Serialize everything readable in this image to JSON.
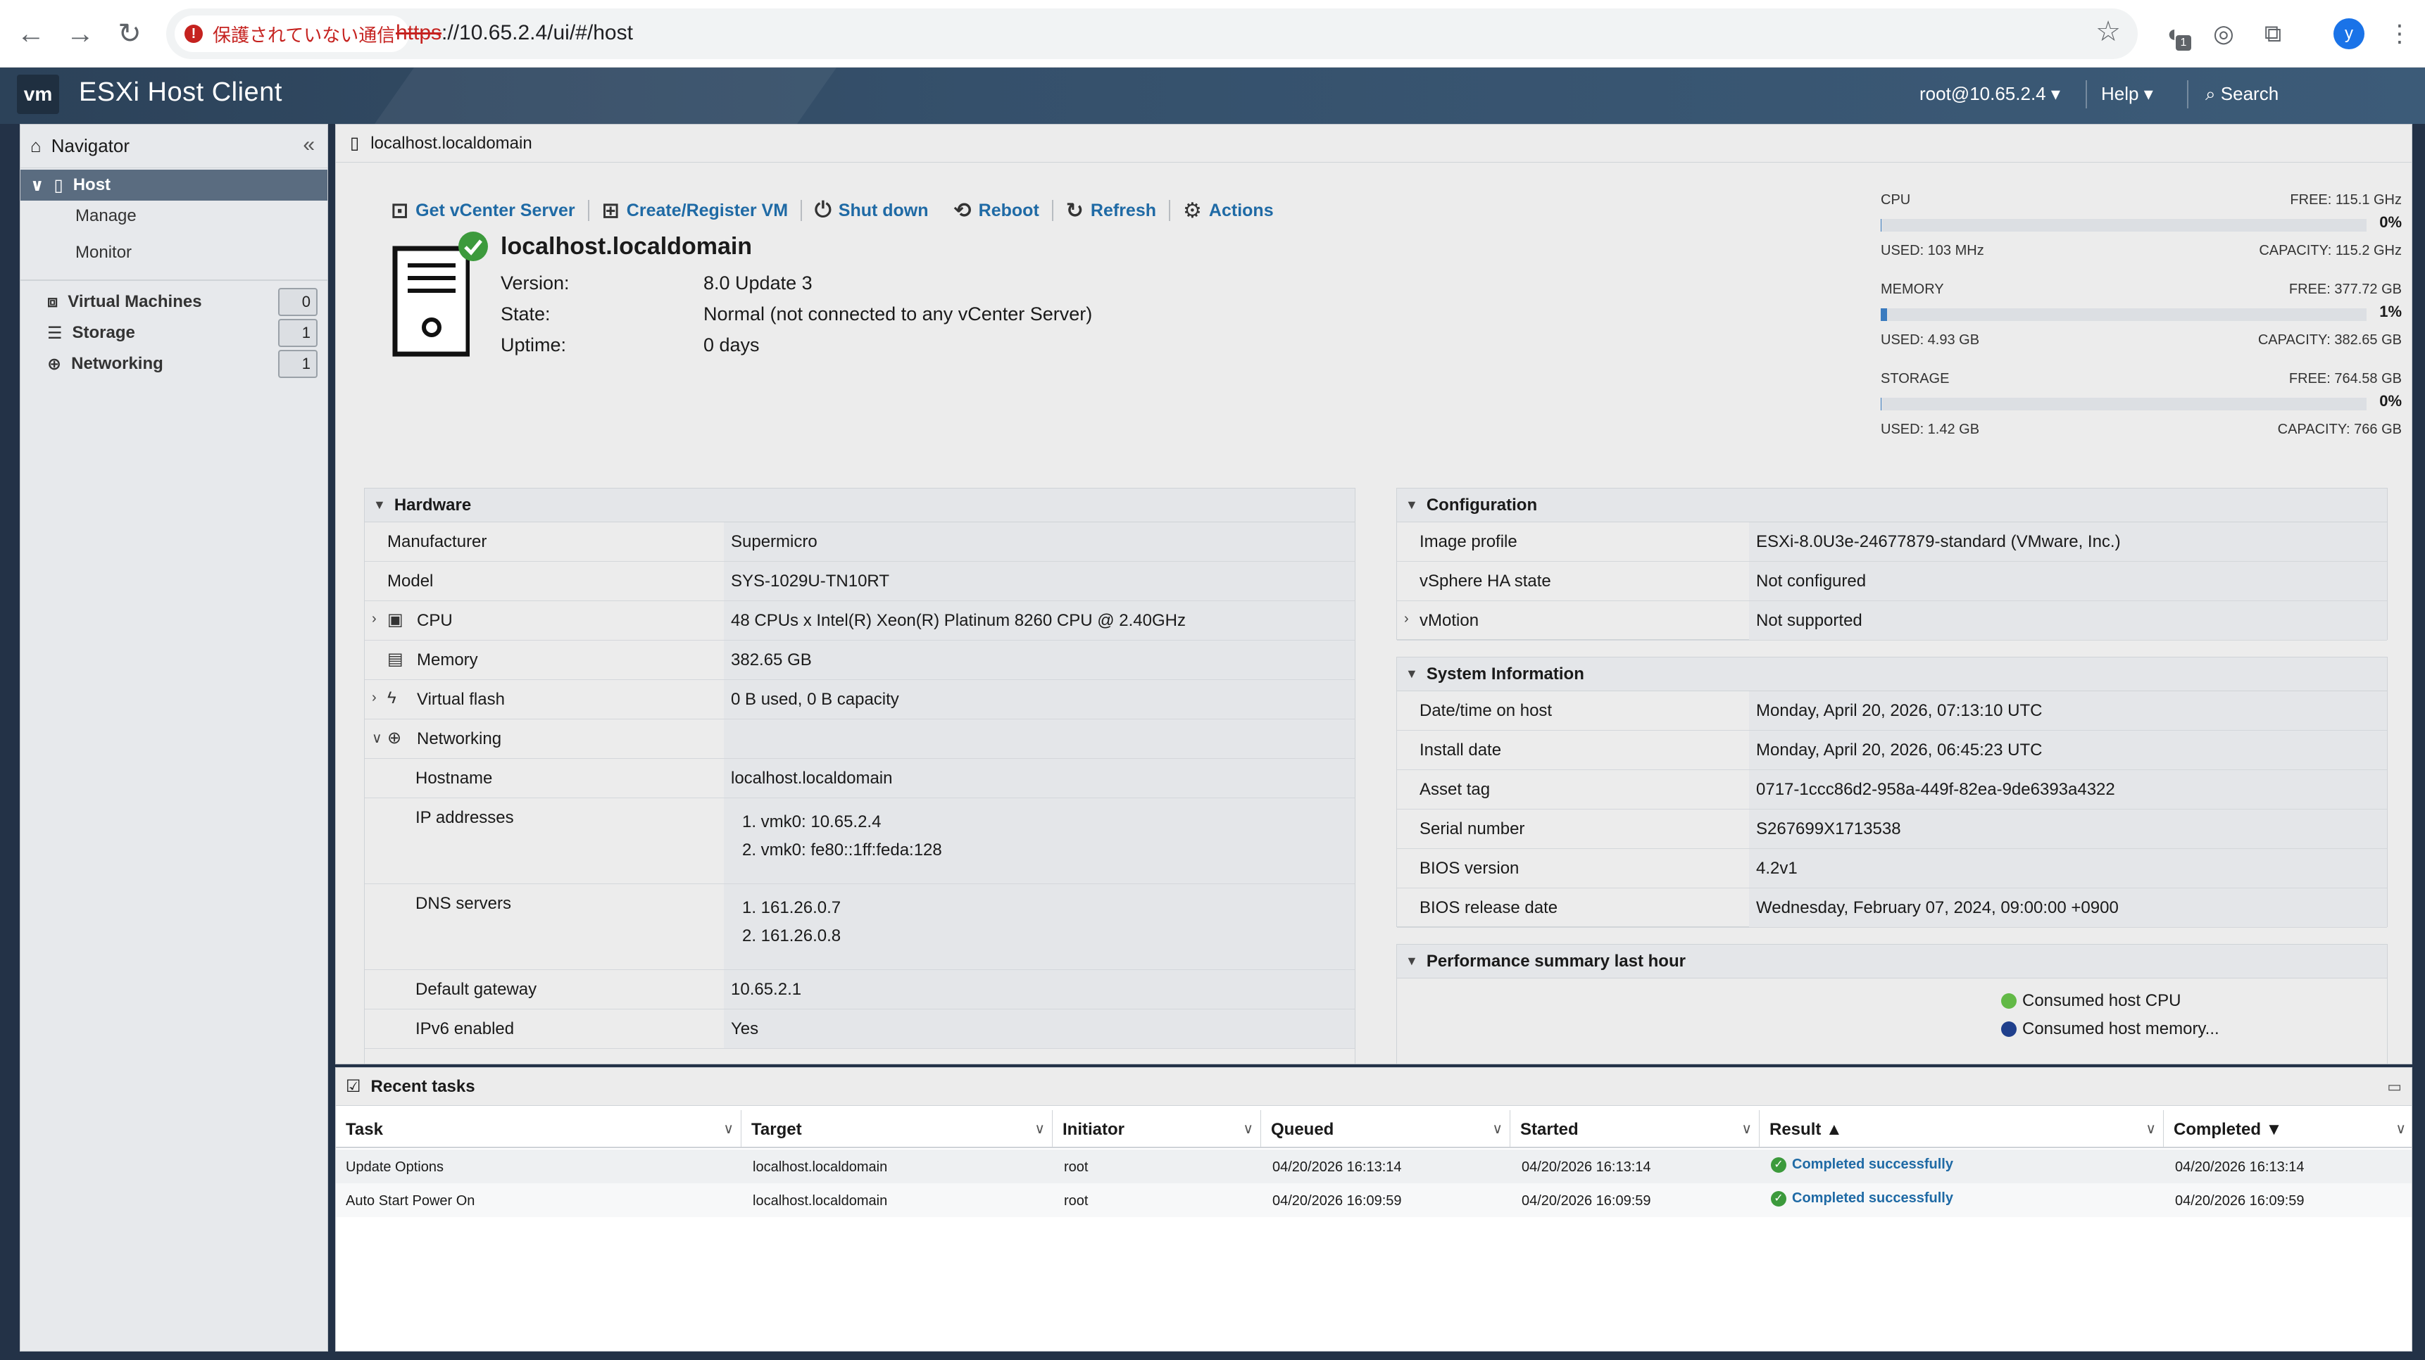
{
  "browser": {
    "security_text": "保護されていない通信",
    "url_scheme": "https",
    "url_rest": "://10.65.2.4/ui/#/host",
    "ext_badge": "1",
    "profile_initial": "y"
  },
  "app": {
    "logo": "vm",
    "title": "ESXi Host Client",
    "user_menu": "root@10.65.2.4 ▾",
    "help_menu": "Help ▾",
    "search_label": "Search"
  },
  "navigator": {
    "title": "Navigator",
    "host_label": "Host",
    "sub_items": [
      "Manage",
      "Monitor"
    ],
    "items": [
      {
        "label": "Virtual Machines",
        "count": "0"
      },
      {
        "label": "Storage",
        "count": "1"
      },
      {
        "label": "Networking",
        "count": "1"
      }
    ]
  },
  "main": {
    "title": "localhost.localdomain",
    "toolbar": {
      "vcenter": "Get vCenter Server",
      "create_vm": "Create/Register VM",
      "shutdown": "Shut down",
      "reboot": "Reboot",
      "refresh": "Refresh",
      "actions": "Actions"
    },
    "host": {
      "name": "localhost.localdomain",
      "version_label": "Version:",
      "version": "8.0 Update 3",
      "state_label": "State:",
      "state": "Normal (not connected to any vCenter Server)",
      "uptime_label": "Uptime:",
      "uptime": "0 days"
    },
    "resources": {
      "cpu": {
        "name": "CPU",
        "free": "FREE: 115.1 GHz",
        "pct": "0%",
        "used": "USED: 103 MHz",
        "capacity": "CAPACITY: 115.2 GHz",
        "fill": 0.1
      },
      "memory": {
        "name": "MEMORY",
        "free": "FREE: 377.72 GB",
        "pct": "1%",
        "used": "USED: 4.93 GB",
        "capacity": "CAPACITY: 382.65 GB",
        "fill": 1.3
      },
      "storage": {
        "name": "STORAGE",
        "free": "FREE: 764.58 GB",
        "pct": "0%",
        "used": "USED: 1.42 GB",
        "capacity": "CAPACITY: 766 GB",
        "fill": 0.2
      }
    },
    "hardware": {
      "title": "Hardware",
      "manufacturer_label": "Manufacturer",
      "manufacturer": "Supermicro",
      "model_label": "Model",
      "model": "SYS-1029U-TN10RT",
      "cpu_label": "CPU",
      "cpu": "48 CPUs x Intel(R) Xeon(R) Platinum 8260 CPU @ 2.40GHz",
      "memory_label": "Memory",
      "memory": "382.65 GB",
      "vflash_label": "Virtual flash",
      "vflash": "0 B used, 0 B capacity",
      "networking_label": "Networking",
      "hostname_label": "Hostname",
      "hostname": "localhost.localdomain",
      "ip_label": "IP addresses",
      "ips": [
        "1. vmk0: 10.65.2.4",
        "2. vmk0: fe80::1ff:feda:128"
      ],
      "dns_label": "DNS servers",
      "dns": [
        "1. 161.26.0.7",
        "2. 161.26.0.8"
      ],
      "gateway_label": "Default gateway",
      "gateway": "10.65.2.1",
      "ipv6_label": "IPv6 enabled",
      "ipv6": "Yes"
    },
    "configuration": {
      "title": "Configuration",
      "image_label": "Image profile",
      "image": "ESXi-8.0U3e-24677879-standard (VMware, Inc.)",
      "ha_label": "vSphere HA state",
      "ha": "Not configured",
      "vmotion_label": "vMotion",
      "vmotion": "Not supported"
    },
    "system_info": {
      "title": "System Information",
      "datetime_label": "Date/time on host",
      "datetime": "Monday, April 20, 2026, 07:13:10 UTC",
      "install_label": "Install date",
      "install": "Monday, April 20, 2026, 06:45:23 UTC",
      "asset_label": "Asset tag",
      "asset": "0717-1ccc86d2-958a-449f-82ea-9de6393a4322",
      "serial_label": "Serial number",
      "serial": "S267699X1713538",
      "bios_label": "BIOS version",
      "bios": "4.2v1",
      "bios_date_label": "BIOS release date",
      "bios_date": "Wednesday, February 07, 2024, 09:00:00 +0900"
    },
    "performance": {
      "title": "Performance summary last hour",
      "legend_cpu": "Consumed host CPU",
      "legend_mem": "Consumed host memory...",
      "cpu_color": "#62b946",
      "mem_color": "#1f3f8c"
    }
  },
  "tasks": {
    "title": "Recent tasks",
    "columns": [
      "Task",
      "Target",
      "Initiator",
      "Queued",
      "Started",
      "Result ▲",
      "Completed ▼"
    ],
    "rows": [
      {
        "task": "Update Options",
        "target": "localhost.localdomain",
        "initiator": "root",
        "queued": "04/20/2026 16:13:14",
        "started": "04/20/2026 16:13:14",
        "result": "Completed successfully",
        "completed": "04/20/2026 16:13:14"
      },
      {
        "task": "Auto Start Power On",
        "target": "localhost.localdomain",
        "initiator": "root",
        "queued": "04/20/2026 16:09:59",
        "started": "04/20/2026 16:09:59",
        "result": "Completed successfully",
        "completed": "04/20/2026 16:09:59"
      }
    ]
  }
}
